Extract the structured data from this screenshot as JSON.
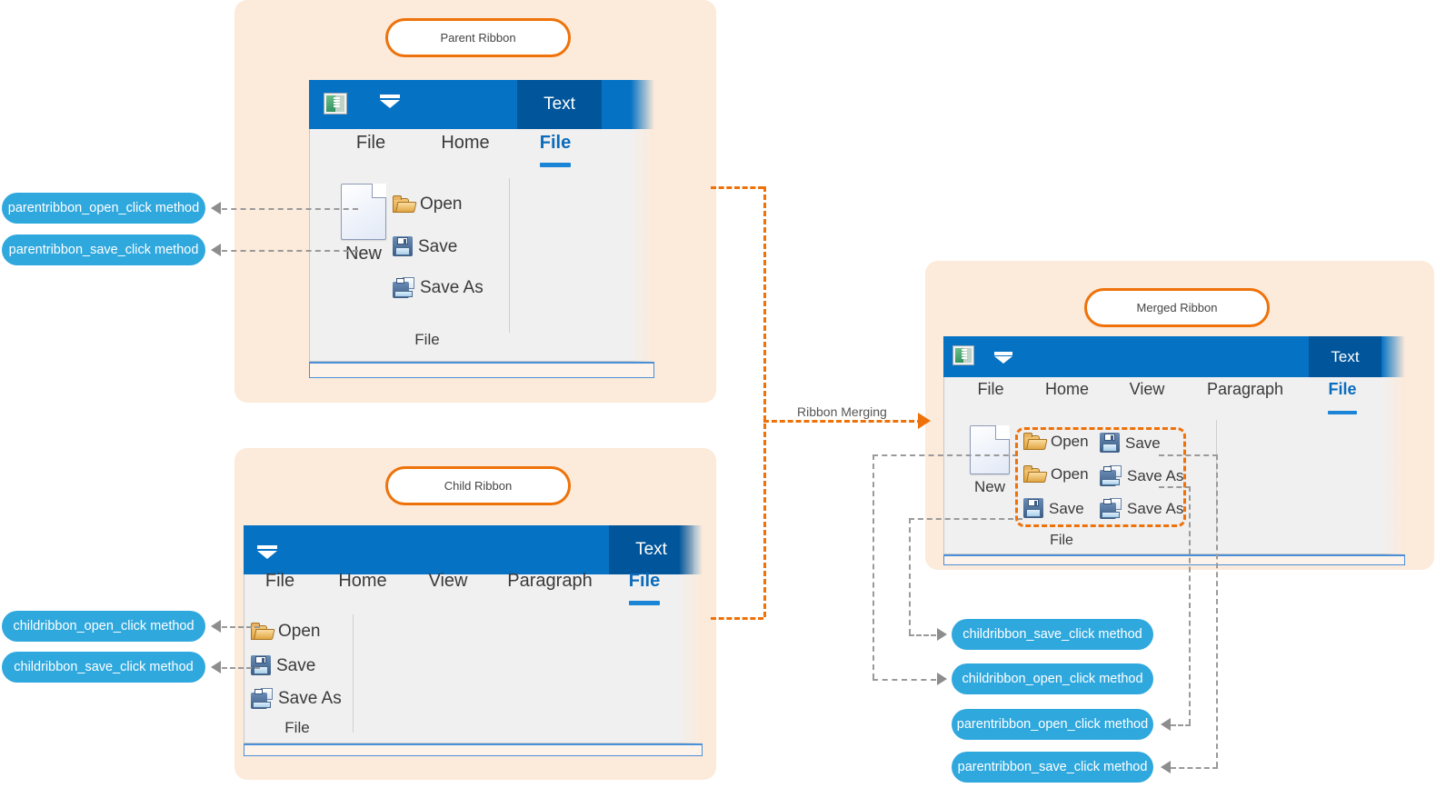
{
  "panels": {
    "parent": {
      "title": "Parent Ribbon"
    },
    "child": {
      "title": "Child Ribbon"
    },
    "merged": {
      "title": "Merged Ribbon"
    }
  },
  "flow": {
    "merge_label": "Ribbon Merging"
  },
  "parent_ribbon": {
    "text_button": "Text",
    "tabs": [
      {
        "label": "File",
        "active": false
      },
      {
        "label": "Home",
        "active": false
      },
      {
        "label": "File",
        "active": true
      }
    ],
    "big_button": {
      "label": "New",
      "icon": "page-icon"
    },
    "items": [
      {
        "label": "Open",
        "icon": "folder-icon"
      },
      {
        "label": "Save",
        "icon": "save-icon"
      },
      {
        "label": "Save As",
        "icon": "save-as-icon"
      }
    ],
    "group_label": "File"
  },
  "child_ribbon": {
    "text_button": "Text",
    "tabs": [
      {
        "label": "File",
        "active": false
      },
      {
        "label": "Home",
        "active": false
      },
      {
        "label": "View",
        "active": false
      },
      {
        "label": "Paragraph",
        "active": false
      },
      {
        "label": "File",
        "active": true
      }
    ],
    "items": [
      {
        "label": "Open",
        "icon": "folder-icon"
      },
      {
        "label": "Save",
        "icon": "save-icon"
      },
      {
        "label": "Save As",
        "icon": "save-as-icon"
      }
    ],
    "group_label": "File"
  },
  "merged_ribbon": {
    "text_button": "Text",
    "tabs": [
      {
        "label": "File",
        "active": false
      },
      {
        "label": "Home",
        "active": false
      },
      {
        "label": "View",
        "active": false
      },
      {
        "label": "Paragraph",
        "active": false
      },
      {
        "label": "File",
        "active": true
      }
    ],
    "big_button": {
      "label": "New",
      "icon": "page-icon"
    },
    "items": [
      {
        "label": "Open",
        "icon": "folder-icon"
      },
      {
        "label": "Save",
        "icon": "save-icon"
      },
      {
        "label": "Open",
        "icon": "folder-icon"
      },
      {
        "label": "Save As",
        "icon": "save-as-icon"
      },
      {
        "label": "Save",
        "icon": "save-icon"
      },
      {
        "label": "Save As",
        "icon": "save-as-icon"
      }
    ],
    "group_label": "File"
  },
  "methods": {
    "parent_open": "parentribbon_open_click method",
    "parent_save": "parentribbon_save_click method",
    "child_open": "childribbon_open_click method",
    "child_save": "childribbon_save_click method",
    "merged_child_save": "childribbon_save_click method",
    "merged_child_open": "childribbon_open_click method",
    "merged_parent_open": "parentribbon_open_click method",
    "merged_parent_save": "parentribbon_save_click method"
  },
  "colors": {
    "panel_bg": "#FCEADA",
    "accent_orange": "#EE7209",
    "pill_blue": "#2FA8DE",
    "ribbon_blue": "#0572C4",
    "ribbon_blue_dark": "#00559B",
    "connector_gray": "#9A9A9A"
  }
}
